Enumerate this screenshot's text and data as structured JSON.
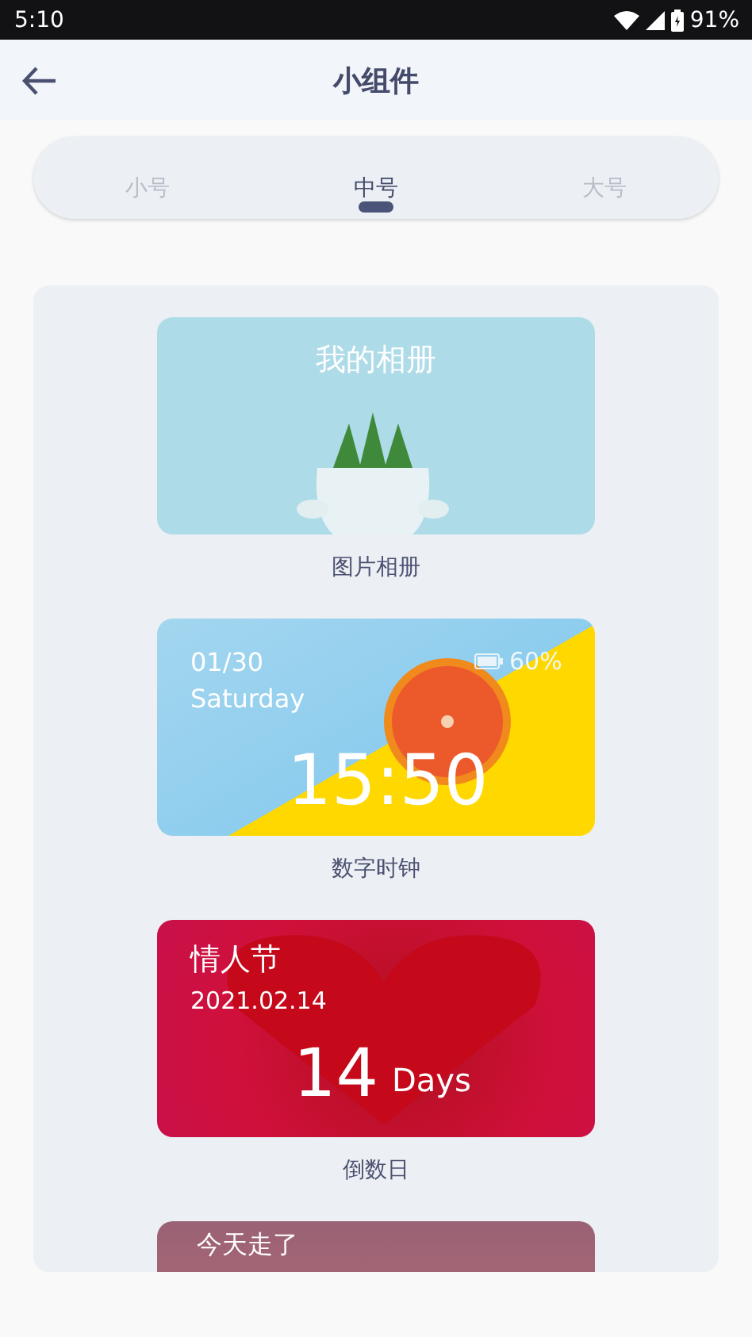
{
  "status_bar": {
    "time": "5:10",
    "battery": "91%"
  },
  "header": {
    "title": "小组件"
  },
  "tabs": [
    {
      "label": "小号",
      "selected": false
    },
    {
      "label": "中号",
      "selected": true
    },
    {
      "label": "大号",
      "selected": false
    }
  ],
  "widgets": [
    {
      "kind": "album",
      "title": "我的相册",
      "caption": "图片相册"
    },
    {
      "kind": "clock",
      "date": "01/30",
      "weekday": "Saturday",
      "battery": "60%",
      "time": "15:50",
      "caption": "数字时钟"
    },
    {
      "kind": "countdown",
      "title": "情人节",
      "date": "2021.02.14",
      "number": "14",
      "unit": "Days",
      "caption": "倒数日"
    },
    {
      "kind": "steps",
      "title": "今天走了"
    }
  ]
}
